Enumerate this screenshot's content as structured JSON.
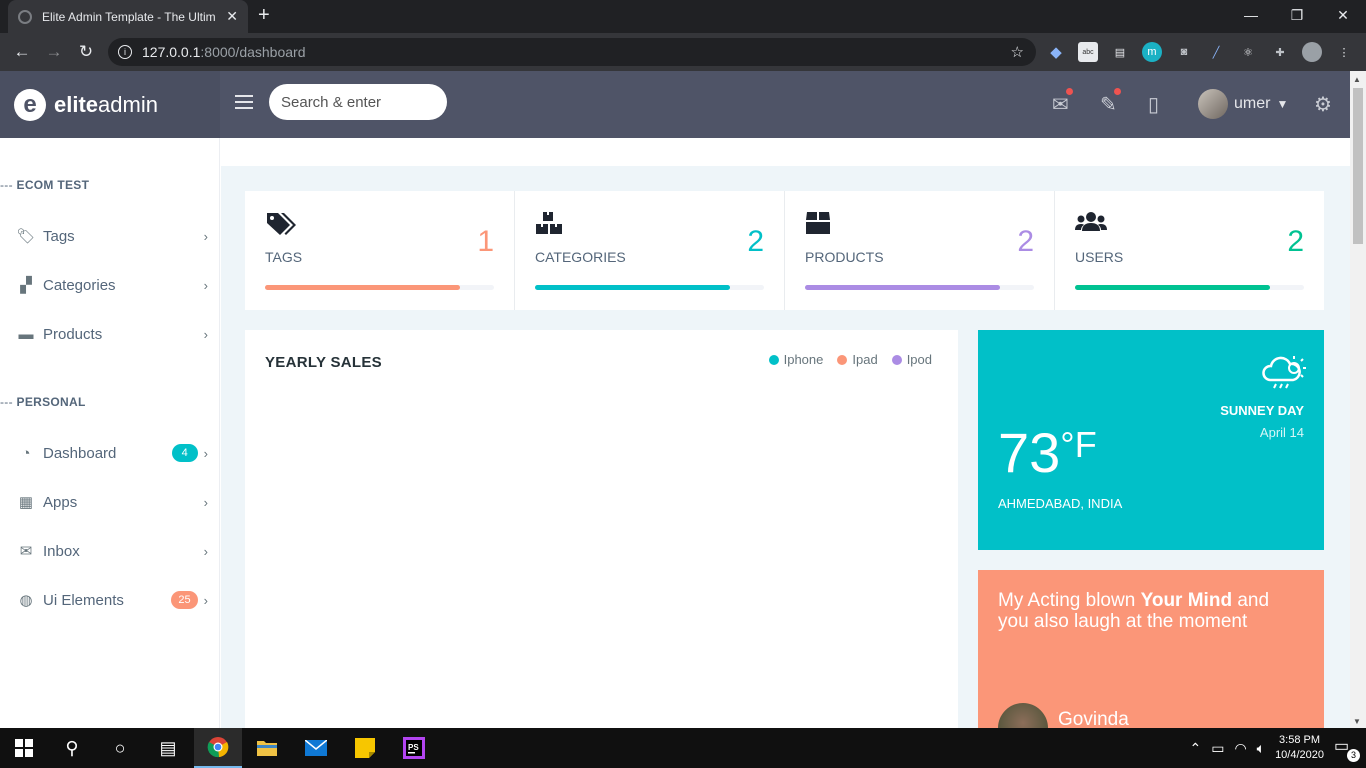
{
  "browser": {
    "tab_title": "Elite Admin Template - The Ultim",
    "url_host": "127.0.0.1",
    "url_path": ":8000/dashboard"
  },
  "brand": {
    "bold": "elite",
    "light": "admin"
  },
  "header": {
    "search_placeholder": "Search & enter",
    "user_name": "umer"
  },
  "sidebar": {
    "sections": [
      {
        "caption": "ECOM TEST",
        "dash": "--- "
      },
      {
        "caption": "PERSONAL",
        "dash": "--- "
      }
    ],
    "items": [
      {
        "label": "Tags",
        "icon": "tag-icon"
      },
      {
        "label": "Categories",
        "icon": "cubes-icon"
      },
      {
        "label": "Products",
        "icon": "archive-icon"
      },
      {
        "label": "Dashboard",
        "icon": "gauge-icon",
        "badge": "4",
        "badge_color": "#01c0c8"
      },
      {
        "label": "Apps",
        "icon": "grid-icon"
      },
      {
        "label": "Inbox",
        "icon": "envelope-icon"
      },
      {
        "label": "Ui Elements",
        "icon": "palette-icon",
        "badge": "25",
        "badge_color": "#fb9678"
      }
    ]
  },
  "stats": [
    {
      "label": "TAGS",
      "value": "1",
      "color": "#fb9678",
      "progress": 0.85
    },
    {
      "label": "CATEGORIES",
      "value": "2",
      "color": "#01c0c8",
      "progress": 0.85
    },
    {
      "label": "PRODUCTS",
      "value": "2",
      "color": "#ab8ce4",
      "progress": 0.85
    },
    {
      "label": "USERS",
      "value": "2",
      "color": "#00c292",
      "progress": 0.85
    }
  ],
  "sales": {
    "title": "YEARLY SALES",
    "legend": [
      {
        "name": "Iphone",
        "color": "#01c0c8"
      },
      {
        "name": "Ipad",
        "color": "#fb9678"
      },
      {
        "name": "Ipod",
        "color": "#ab8ce4"
      }
    ]
  },
  "weather": {
    "condition": "SUNNEY DAY",
    "date": "April 14",
    "temp": "73",
    "unit": "°F",
    "location": "AHMEDABAD, INDIA"
  },
  "quote": {
    "text_pre": "My Acting blown ",
    "text_bold": "Your Mind",
    "text_post": " and you also laugh at the moment",
    "author": "Govinda"
  },
  "taskbar": {
    "time": "3:58 PM",
    "date": "10/4/2020",
    "notifications": "3"
  }
}
